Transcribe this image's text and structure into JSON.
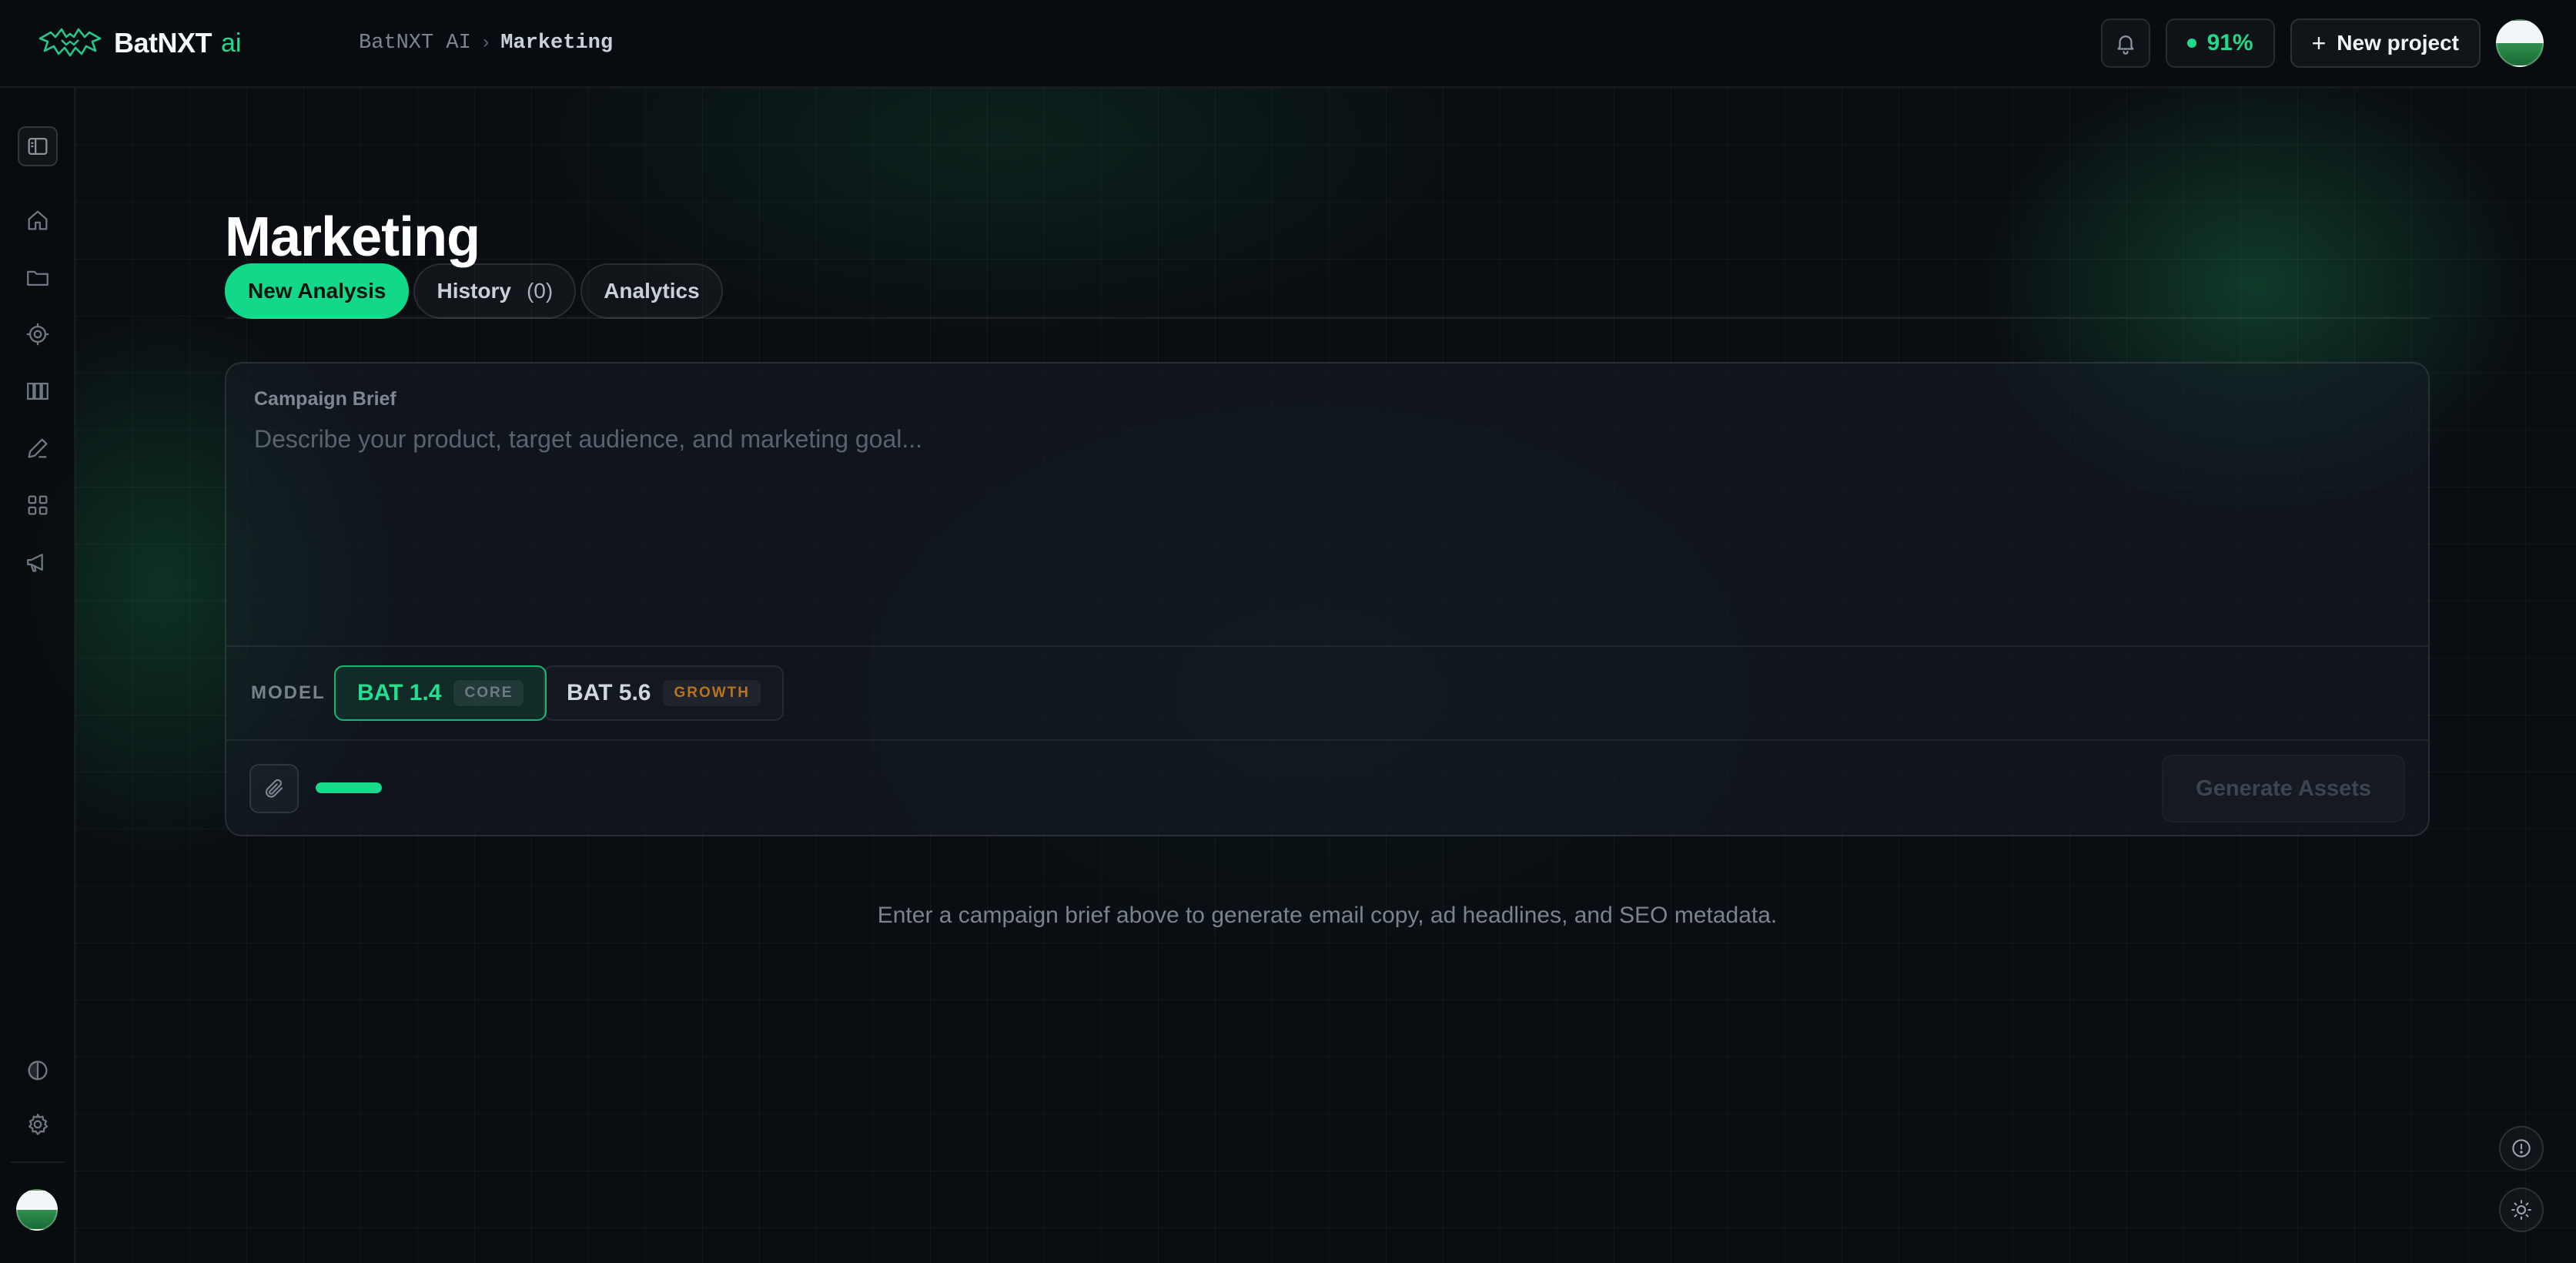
{
  "app": {
    "brand_name": "BatNXT",
    "brand_suffix": "ai"
  },
  "breadcrumb": {
    "root": "BatNXT AI",
    "separator": "›",
    "current": "Marketing"
  },
  "topbar": {
    "score": "91%",
    "new_project_label": "New project"
  },
  "page": {
    "title": "Marketing"
  },
  "tabs": [
    {
      "label": "New Analysis",
      "active": true
    },
    {
      "label": "History",
      "count": "(0)",
      "active": false
    },
    {
      "label": "Analytics",
      "active": false
    }
  ],
  "brief": {
    "label": "Campaign Brief",
    "placeholder": "Describe your product, target audience, and marketing goal...",
    "value": ""
  },
  "models": {
    "label": "MODEL",
    "options": [
      {
        "name": "BAT 1.4",
        "tag": "CORE",
        "selected": true
      },
      {
        "name": "BAT 5.6",
        "tag": "GROWTH",
        "selected": false
      }
    ]
  },
  "actions": {
    "generate_label": "Generate Assets",
    "progress": 1.0
  },
  "helper_text": "Enter a campaign brief above to generate email copy, ad headlines, and SEO metadata.",
  "colors": {
    "accent": "#12d98a",
    "background": "#0a0d12",
    "growth_tag": "#b8741d"
  },
  "icons": {
    "sidebar": [
      "panel-toggle-icon",
      "home-icon",
      "folder-icon",
      "target-icon",
      "library-icon",
      "pen-icon",
      "apps-grid-icon",
      "megaphone-icon",
      "contrast-icon",
      "gear-icon"
    ],
    "topbar": [
      "bell-icon",
      "plus-icon"
    ],
    "floating": [
      "info-icon",
      "sun-icon"
    ]
  }
}
